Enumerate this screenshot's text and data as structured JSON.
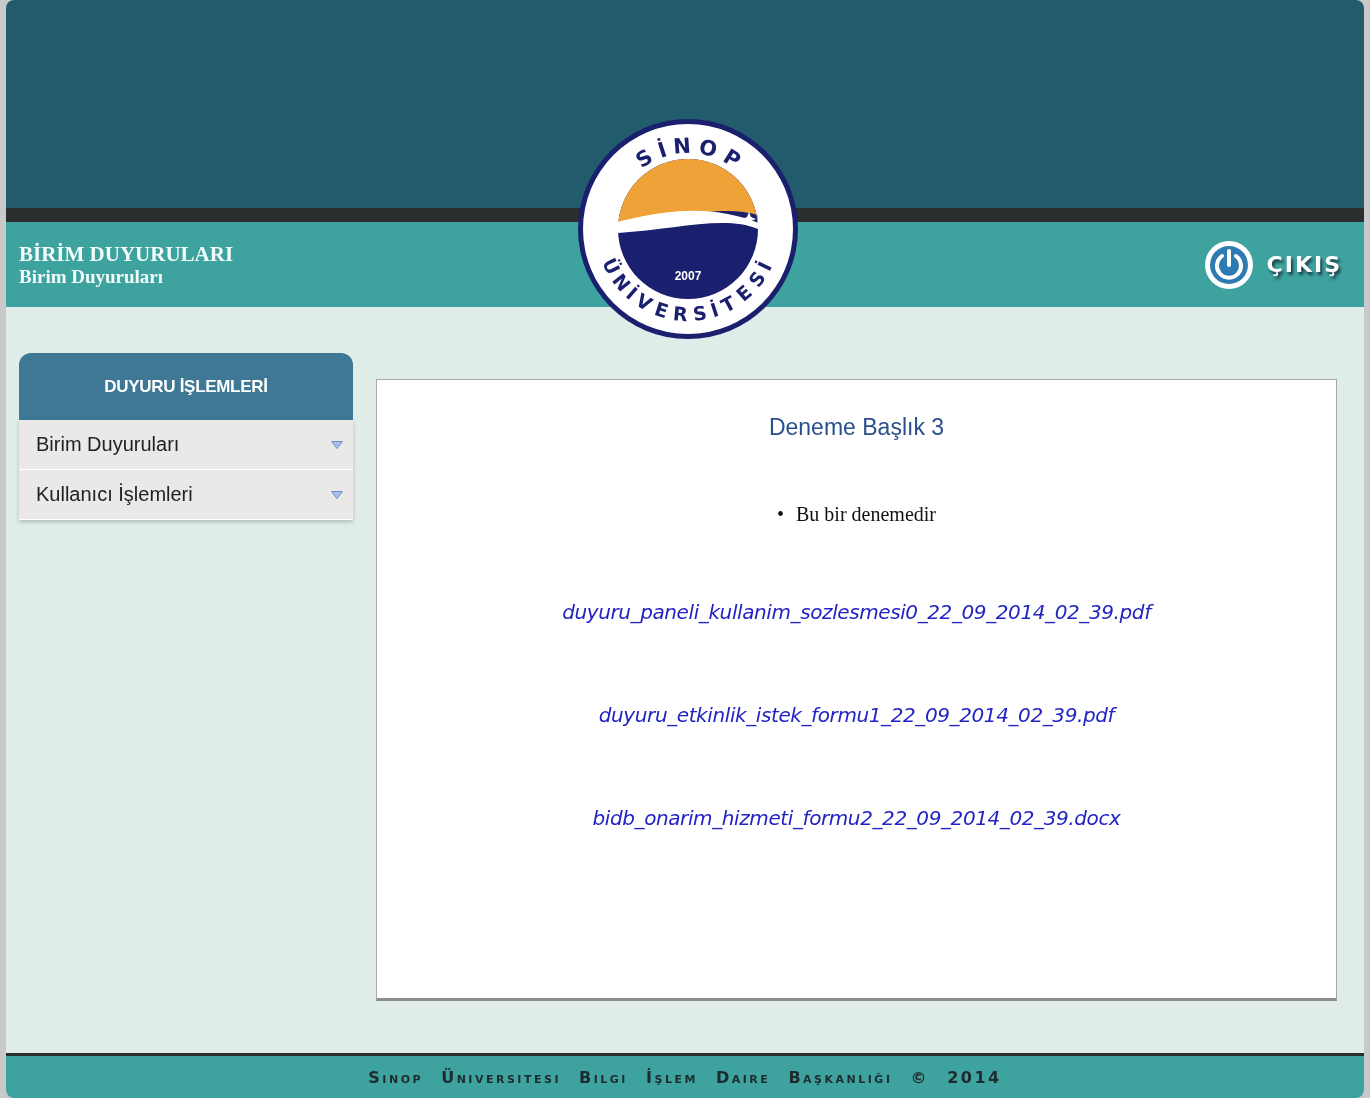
{
  "header": {
    "title": "BİRİM DUYURULARI",
    "subtitle": "Birim Duyuruları",
    "logo": {
      "top_text": "SİNOP",
      "bottom_text": "ÜNİVERSİTESİ",
      "year": "2007"
    },
    "exit_label": "ÇIKIŞ"
  },
  "sidebar": {
    "title": "DUYURU İŞLEMLERİ",
    "items": [
      {
        "label": "Birim Duyuruları"
      },
      {
        "label": "Kullanıcı İşlemleri"
      }
    ]
  },
  "announcement": {
    "title": "Deneme Başlık 3",
    "bullets": [
      {
        "marker": "•",
        "text": "Bu bir denemedir"
      }
    ],
    "attachments": [
      "duyuru_paneli_kullanim_sozlesmesi0_22_09_2014_02_39.pdf",
      "duyuru_etkinlik_istek_formu1_22_09_2014_02_39.pdf",
      "bidb_onarim_hizmeti_formu2_22_09_2014_02_39.docx"
    ]
  },
  "footer": "Sinop Üniversitesi Bilgi İşlem Daire Başkanlığı © 2014"
}
